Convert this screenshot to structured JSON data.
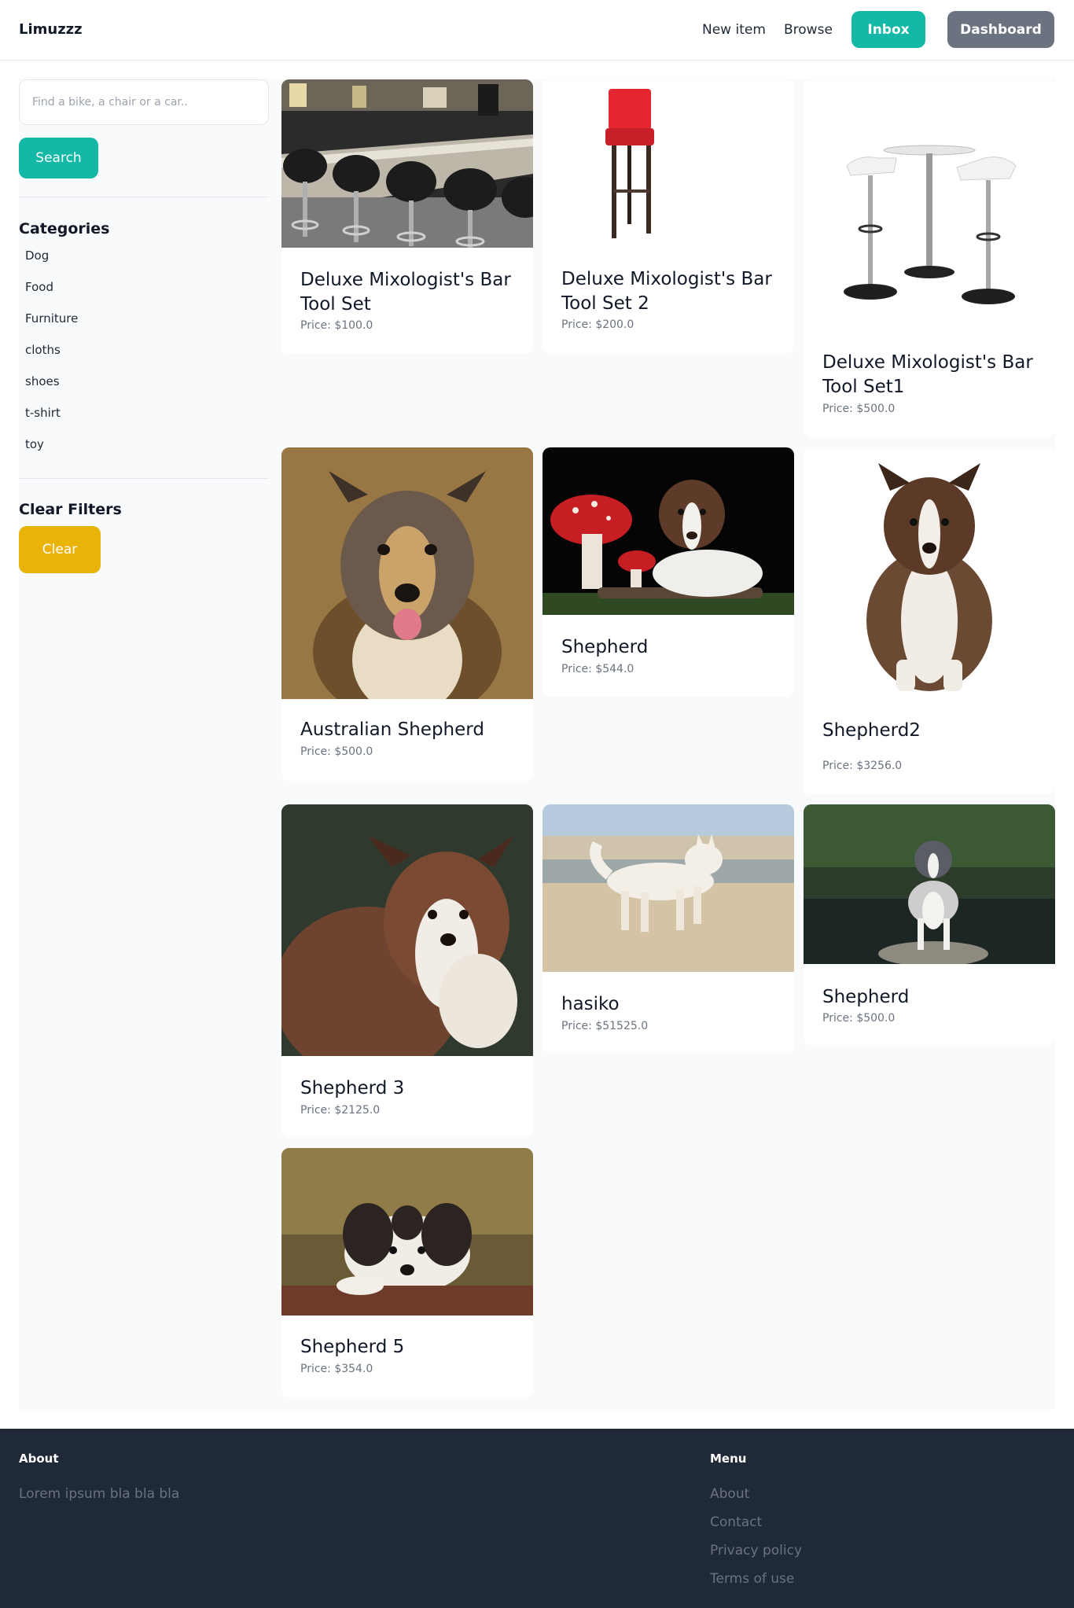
{
  "header": {
    "brand": "Limuzzz",
    "new_item": "New item",
    "browse": "Browse",
    "inbox": "Inbox",
    "dashboard": "Dashboard"
  },
  "sidebar": {
    "search_placeholder": "Find a bike, a chair or a car..",
    "search_button": "Search",
    "categories_heading": "Categories",
    "categories": [
      "Dog",
      "Food",
      "Furniture",
      "cloths",
      "shoes",
      "t-shirt",
      "toy"
    ],
    "clear_heading": "Clear Filters",
    "clear_button": "Clear"
  },
  "items": [
    {
      "title": "Deluxe Mixologist's Bar Tool Set",
      "price": "Price: $100.0",
      "image": "bar-stools-counter"
    },
    {
      "title": "Deluxe Mixologist's Bar Tool Set 2",
      "price": "Price: $200.0",
      "image": "red-bar-stool"
    },
    {
      "title": "Deluxe Mixologist's Bar Tool Set1",
      "price": "Price: $500.0",
      "image": "white-stools-table"
    },
    {
      "title": "Australian Shepherd",
      "price": "Price: $500.0",
      "image": "australian-shepherd-portrait"
    },
    {
      "title": "Shepherd",
      "price": "Price: $544.0",
      "image": "puppy-with-mushroom"
    },
    {
      "title": "Shepherd2",
      "price": "Price: $3256.0",
      "image": "sitting-shepherd"
    },
    {
      "title": "Shepherd 3",
      "price": "Price: $2125.0",
      "image": "shepherd-portrait"
    },
    {
      "title": "hasiko",
      "price": "Price: $51525.0",
      "image": "white-dog-beach"
    },
    {
      "title": "Shepherd",
      "price": "Price: $500.0",
      "image": "shepherd-on-rock"
    },
    {
      "title": "Shepherd 5",
      "price": "Price: $354.0",
      "image": "dog-on-log"
    }
  ],
  "footer": {
    "about_heading": "About",
    "about_text": "Lorem ipsum bla bla bla",
    "menu_heading": "Menu",
    "menu_links": [
      "About",
      "Contact",
      "Privacy policy",
      "Terms of use"
    ]
  }
}
